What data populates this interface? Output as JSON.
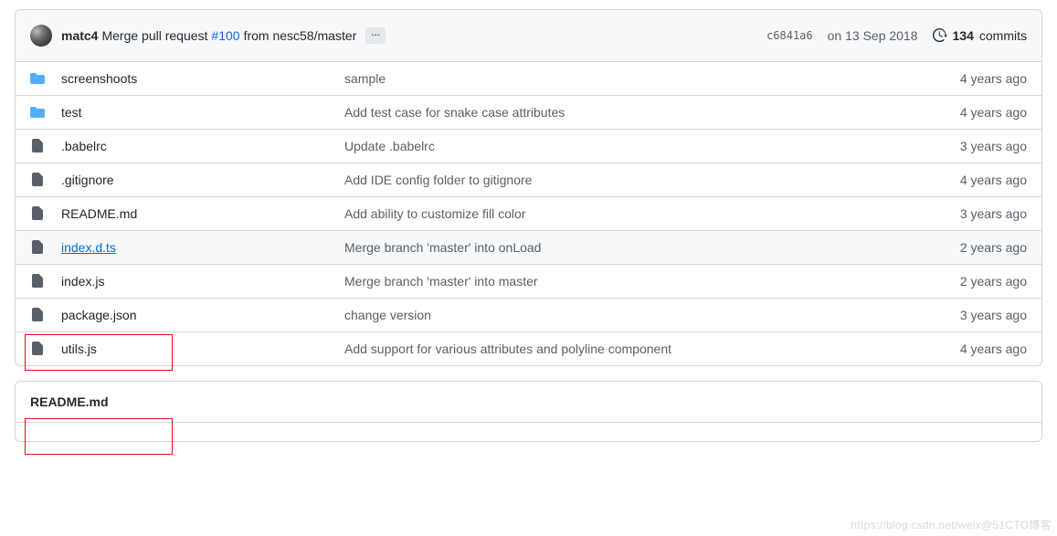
{
  "commit": {
    "author": "matc4",
    "message_prefix": "Merge pull request",
    "pr_ref": "#100",
    "message_suffix": "from nesc58/master",
    "sha": "c6841a6",
    "date": "on 13 Sep 2018",
    "commits_count": "134",
    "commits_label": "commits"
  },
  "files": [
    {
      "type": "dir",
      "name": "screenshoots",
      "msg": "sample",
      "time": "4 years ago",
      "link": false
    },
    {
      "type": "dir",
      "name": "test",
      "msg": "Add test case for snake case attributes",
      "time": "4 years ago",
      "link": false
    },
    {
      "type": "file",
      "name": ".babelrc",
      "msg": "Update .babelrc",
      "time": "3 years ago",
      "link": false
    },
    {
      "type": "file",
      "name": ".gitignore",
      "msg": "Add IDE config folder to gitignore",
      "time": "4 years ago",
      "link": false
    },
    {
      "type": "file",
      "name": "README.md",
      "msg": "Add ability to customize fill color",
      "time": "3 years ago",
      "link": false
    },
    {
      "type": "file",
      "name": "index.d.ts",
      "msg": "Merge branch 'master' into onLoad",
      "time": "2 years ago",
      "link": true
    },
    {
      "type": "file",
      "name": "index.js",
      "msg": "Merge branch 'master' into master",
      "time": "2 years ago",
      "link": false
    },
    {
      "type": "file",
      "name": "package.json",
      "msg": "change version",
      "time": "3 years ago",
      "link": false
    },
    {
      "type": "file",
      "name": "utils.js",
      "msg": "Add support for various attributes and polyline component",
      "time": "4 years ago",
      "link": false
    }
  ],
  "readme": {
    "title": "README.md"
  },
  "watermark": "https://blog.csdn.net/weix@51CTO博客"
}
